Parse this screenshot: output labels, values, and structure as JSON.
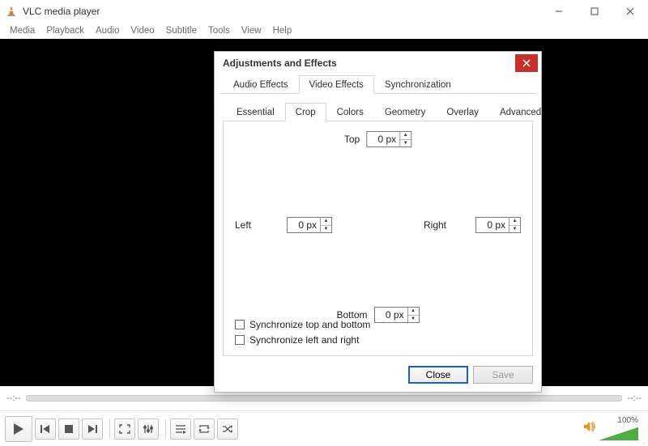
{
  "app": {
    "title": "VLC media player"
  },
  "menu": [
    "Media",
    "Playback",
    "Audio",
    "Video",
    "Subtitle",
    "Tools",
    "View",
    "Help"
  ],
  "seek": {
    "start": "--:--",
    "end": "--:--"
  },
  "volume": {
    "text": "100%"
  },
  "dialog": {
    "title": "Adjustments and Effects",
    "tabs_main": [
      "Audio Effects",
      "Video Effects",
      "Synchronization"
    ],
    "tabs_main_active": 1,
    "tabs_sub": [
      "Essential",
      "Crop",
      "Colors",
      "Geometry",
      "Overlay",
      "Advanced"
    ],
    "tabs_sub_active": 1,
    "crop": {
      "top_label": "Top",
      "top_value": "0 px",
      "left_label": "Left",
      "left_value": "0 px",
      "right_label": "Right",
      "right_value": "0 px",
      "bottom_label": "Bottom",
      "bottom_value": "0 px",
      "sync_tb": "Synchronize top and bottom",
      "sync_lr": "Synchronize left and right"
    },
    "buttons": {
      "close": "Close",
      "save": "Save"
    }
  }
}
